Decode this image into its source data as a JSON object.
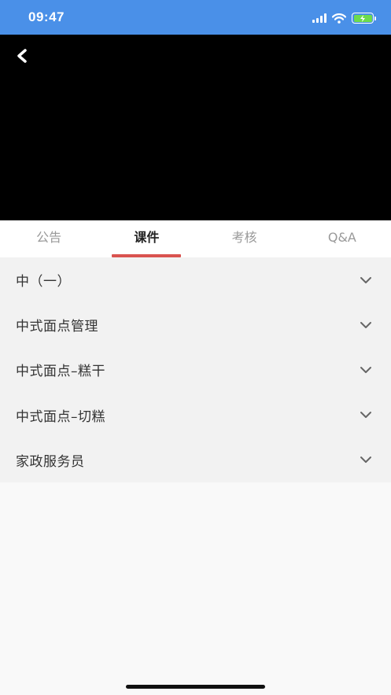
{
  "status_bar": {
    "time": "09:47"
  },
  "tabs": [
    {
      "label": "公告",
      "active": false
    },
    {
      "label": "课件",
      "active": true
    },
    {
      "label": "考核",
      "active": false
    },
    {
      "label": "Q&A",
      "active": false
    }
  ],
  "courses": [
    {
      "label": "中（一）"
    },
    {
      "label": "中式面点管理"
    },
    {
      "label": "中式面点–糕干"
    },
    {
      "label": "中式面点–切糕"
    },
    {
      "label": "家政服务员"
    }
  ],
  "colors": {
    "status_bar": "#4a90e8",
    "active_tab_indicator": "#d9534f",
    "battery_fill": "#6ddc4c"
  },
  "icons": {
    "back": "chevron-left-icon",
    "expand": "chevron-down-icon",
    "signal": "cellular-signal-icon",
    "wifi": "wifi-icon",
    "battery": "battery-charging-icon"
  }
}
